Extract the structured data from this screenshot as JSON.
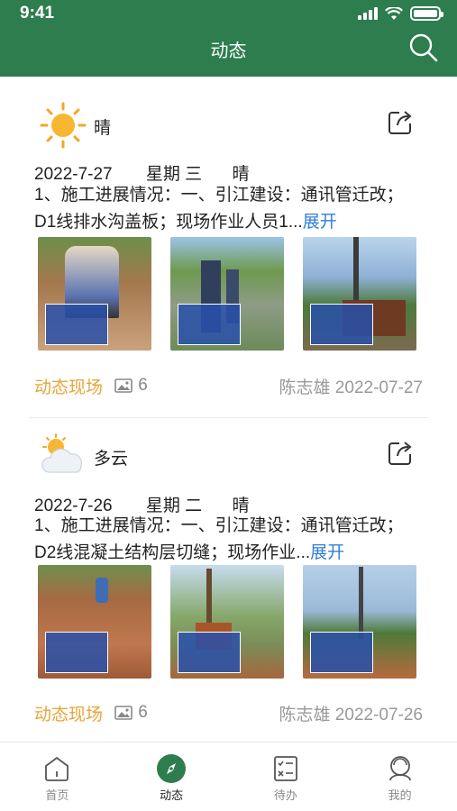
{
  "status_bar": {
    "time": "9:41"
  },
  "header": {
    "title": "动态"
  },
  "posts": [
    {
      "weather": "晴",
      "weather_icon": "sun-icon",
      "date": "2022-7-27",
      "weekday": "星期 三",
      "weather_inline": "晴",
      "desc_line1": "1、施工进展情况：一、引江建设：通讯管迁改；",
      "desc_line2": "D1线排水沟盖板；现场作业人员1...",
      "more": "展开",
      "tag": "动态现场",
      "image_count": "6",
      "author_date": "陈志雄 2022-07-27"
    },
    {
      "weather": "多云",
      "weather_icon": "cloudy-icon",
      "date": "2022-7-26",
      "weekday": "星期 二",
      "weather_inline": "晴",
      "desc_line1": "1、施工进展情况：一、引江建设：通讯管迁改；",
      "desc_line2": "D2线混凝土结构层切缝；现场作业...",
      "more": "展开",
      "tag": "动态现场",
      "image_count": "6",
      "author_date": "陈志雄 2022-07-26"
    }
  ],
  "tabs": [
    {
      "label": "首页",
      "icon": "home-icon"
    },
    {
      "label": "动态",
      "icon": "compass-icon",
      "active": true
    },
    {
      "label": "待办",
      "icon": "todo-icon"
    },
    {
      "label": "我的",
      "icon": "profile-icon"
    }
  ],
  "colors": {
    "brand": "#2e7d4f",
    "link": "#2e7fd4",
    "tag": "#e8a53a"
  }
}
